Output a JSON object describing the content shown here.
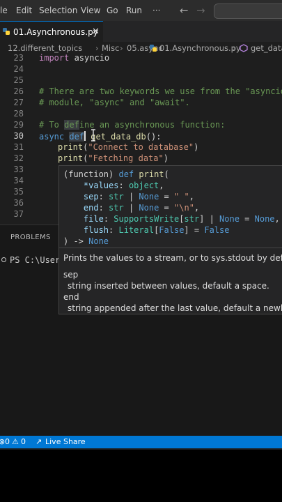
{
  "menubar": {
    "items": [
      "le",
      "Edit",
      "Selection",
      "View",
      "Go",
      "Run"
    ],
    "more": "···",
    "back": "←",
    "forward": "→"
  },
  "tab": {
    "label": "01.Asynchronous.py",
    "close": "✕"
  },
  "breadcrumb": [
    "12.different_topics",
    "Misc",
    "05.async",
    "01.Asynchronous.py",
    "get_data_"
  ],
  "editor": {
    "line_numbers": [
      "23",
      "24",
      "25",
      "26",
      "27",
      "28",
      "29",
      "30",
      "31",
      "32",
      "33",
      "34",
      "35",
      "36",
      "37"
    ],
    "active_line": "30",
    "line23": {
      "kw": "import",
      "rest": " asyncio"
    },
    "line26": "# There are two keywords we use from the \"asyncio\"",
    "line27": "# module, \"async\" and \"await\".",
    "line29": {
      "a": "# To ",
      "hl": "def",
      "b": "ine an asynchronous function:"
    },
    "line30": {
      "kw1": "async",
      "kw2": "def",
      "fn": "get_data_db",
      "rest": "():"
    },
    "line31": {
      "fn": "print",
      "open": "(",
      "str": "\"Connect to database\"",
      "close": ")"
    },
    "line32": {
      "fn": "print",
      "open": "(",
      "str": "\"Fetching data\"",
      "close": ")"
    }
  },
  "hover": {
    "l1a": "(function) ",
    "l1kw": "def",
    "l1fn": " print",
    "l1b": "(",
    "l2p": "*values",
    "l2c": ": ",
    "l2t": "object",
    "l2e": ",",
    "l3p": "sep",
    "l3c": ": ",
    "l3t": "str",
    "l3bar": " | ",
    "l3n": "None",
    "l3eq": " = ",
    "l3v": "\" \"",
    "l3e": ",",
    "l4p": "end",
    "l4c": ": ",
    "l4t": "str",
    "l4bar": " | ",
    "l4n": "None",
    "l4eq": " = ",
    "l4v": "\"\\n\"",
    "l4e": ",",
    "l5p": "file",
    "l5c": ": ",
    "l5t": "SupportsWrite",
    "l5o": "[",
    "l5t2": "str",
    "l5cl": "]",
    "l5bar": " | ",
    "l5n": "None",
    "l5eq": " = ",
    "l5v": "None",
    "l5e": ",",
    "l6p": "flush",
    "l6c": ": ",
    "l6t": "Literal",
    "l6o": "[",
    "l6f": "False",
    "l6cl": "]",
    "l6eq": " = ",
    "l6v": "False",
    "l7a": ") -> ",
    "l7n": "None",
    "desc": "Prints the values to a stream, or to sys.stdout by default.",
    "sep_label": "sep",
    "sep_desc": "string inserted between values, default a space.",
    "end_label": "end",
    "end_desc": "string appended after the last value, default a newline."
  },
  "panel": {
    "title": "PROBLEMS",
    "terminal_line": "PS C:\\Users"
  },
  "status": {
    "errors": "0",
    "warnings": "0",
    "live_share": "Live Share"
  }
}
